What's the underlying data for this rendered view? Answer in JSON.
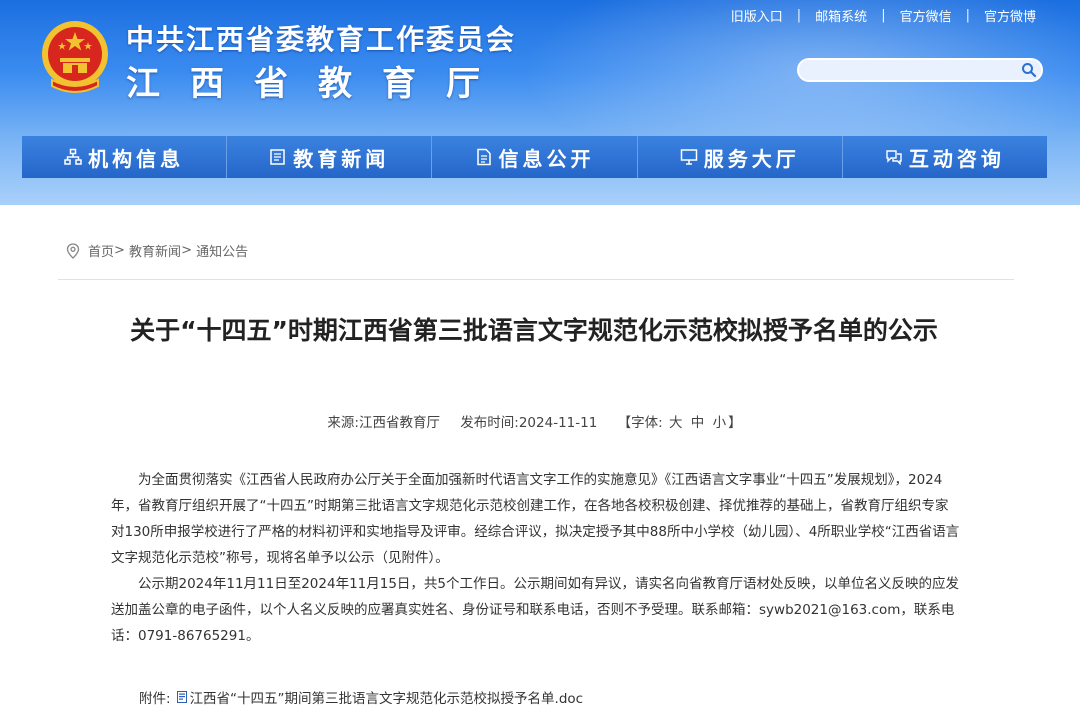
{
  "header": {
    "org_name": "中共江西省委教育工作委员会",
    "dept_name": "江西省教育厅",
    "links": [
      "旧版入口",
      "邮箱系统",
      "官方微信",
      "官方微博"
    ],
    "search_placeholder": ""
  },
  "nav": {
    "items": [
      {
        "label": "机构信息",
        "icon": "org-chart-icon"
      },
      {
        "label": "教育新闻",
        "icon": "news-icon"
      },
      {
        "label": "信息公开",
        "icon": "document-icon"
      },
      {
        "label": "服务大厅",
        "icon": "monitor-icon"
      },
      {
        "label": "互动咨询",
        "icon": "chat-icon"
      }
    ]
  },
  "breadcrumb": {
    "home": "首页",
    "level1": "教育新闻",
    "level2": "通知公告"
  },
  "article": {
    "title": "关于“十四五”时期江西省第三批语言文字规范化示范校拟授予名单的公示",
    "source_label": "来源:",
    "source": "江西省教育厅",
    "date_label": "发布时间:",
    "date": "2024-11-11",
    "font_label": "【字体:",
    "font_large": "大",
    "font_medium": "中",
    "font_small": "小",
    "font_close": "】",
    "paragraphs": [
      "为全面贯彻落实《江西省人民政府办公厅关于全面加强新时代语言文字工作的实施意见》《江西语言文字事业“十四五”发展规划》，2024年，省教育厅组织开展了“十四五”时期第三批语言文字规范化示范校创建工作，在各地各校积极创建、择优推荐的基础上，省教育厅组织专家对130所申报学校进行了严格的材料初评和实地指导及评审。经综合评议，拟决定授予其中88所中小学校（幼儿园）、4所职业学校“江西省语言文字规范化示范校”称号，现将名单予以公示（见附件）。",
      "公示期2024年11月11日至2024年11月15日，共5个工作日。公示期间如有异议，请实名向省教育厅语材处反映，以单位名义反映的应发送加盖公章的电子函件，以个人名义反映的应署真实姓名、身份证号和联系电话，否则不予受理。联系邮箱：sywb2021@163.com，联系电话：0791-86765291。"
    ],
    "attachment_label": "附件:",
    "attachment_name": "江西省“十四五”期间第三批语言文字规范化示范校拟授予名单.doc"
  },
  "colors": {
    "header_blue": "#2b6fd2",
    "emblem_red": "#d7261e",
    "emblem_gold": "#f2c230"
  }
}
